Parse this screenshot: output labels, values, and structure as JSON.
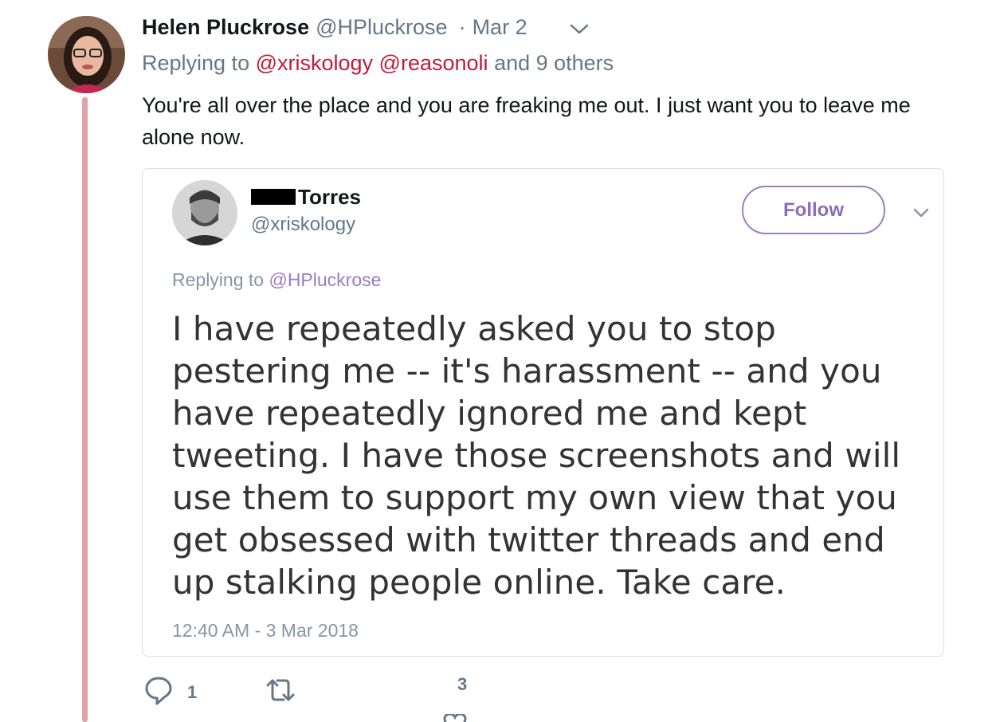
{
  "tweet": {
    "author_name": "Helen Pluckrose",
    "author_handle": "@HPluckrose",
    "separator": "·",
    "date": "Mar 2",
    "replying_prefix": "Replying to",
    "replying_mentions": "@xriskology @reasonoli",
    "replying_suffix": "and 9 others",
    "text": "You're all over the place and you are freaking me out. I just want you to leave me alone now.",
    "reply_count": "1",
    "like_count": "3"
  },
  "quoted": {
    "name": "Torres",
    "handle": "@xriskology",
    "follow_label": "Follow",
    "replying_prefix": "Replying to",
    "replying_mention": "@HPluckrose",
    "text": "I have repeatedly asked you to stop pestering me -- it's harassment -- and you have repeatedly ignored me and kept tweeting. I have those screenshots and will use them to support my own view that you get obsessed with twitter threads and end up stalking people online. Take care.",
    "timestamp": "12:40 AM - 3 Mar 2018"
  },
  "colors": {
    "thread_line": "#e0a3a8",
    "mention": "#c31a3c",
    "follow_accent": "#8c6bb8"
  },
  "icons": [
    "chevron-down-icon",
    "reply-icon",
    "retweet-icon",
    "like-icon"
  ]
}
